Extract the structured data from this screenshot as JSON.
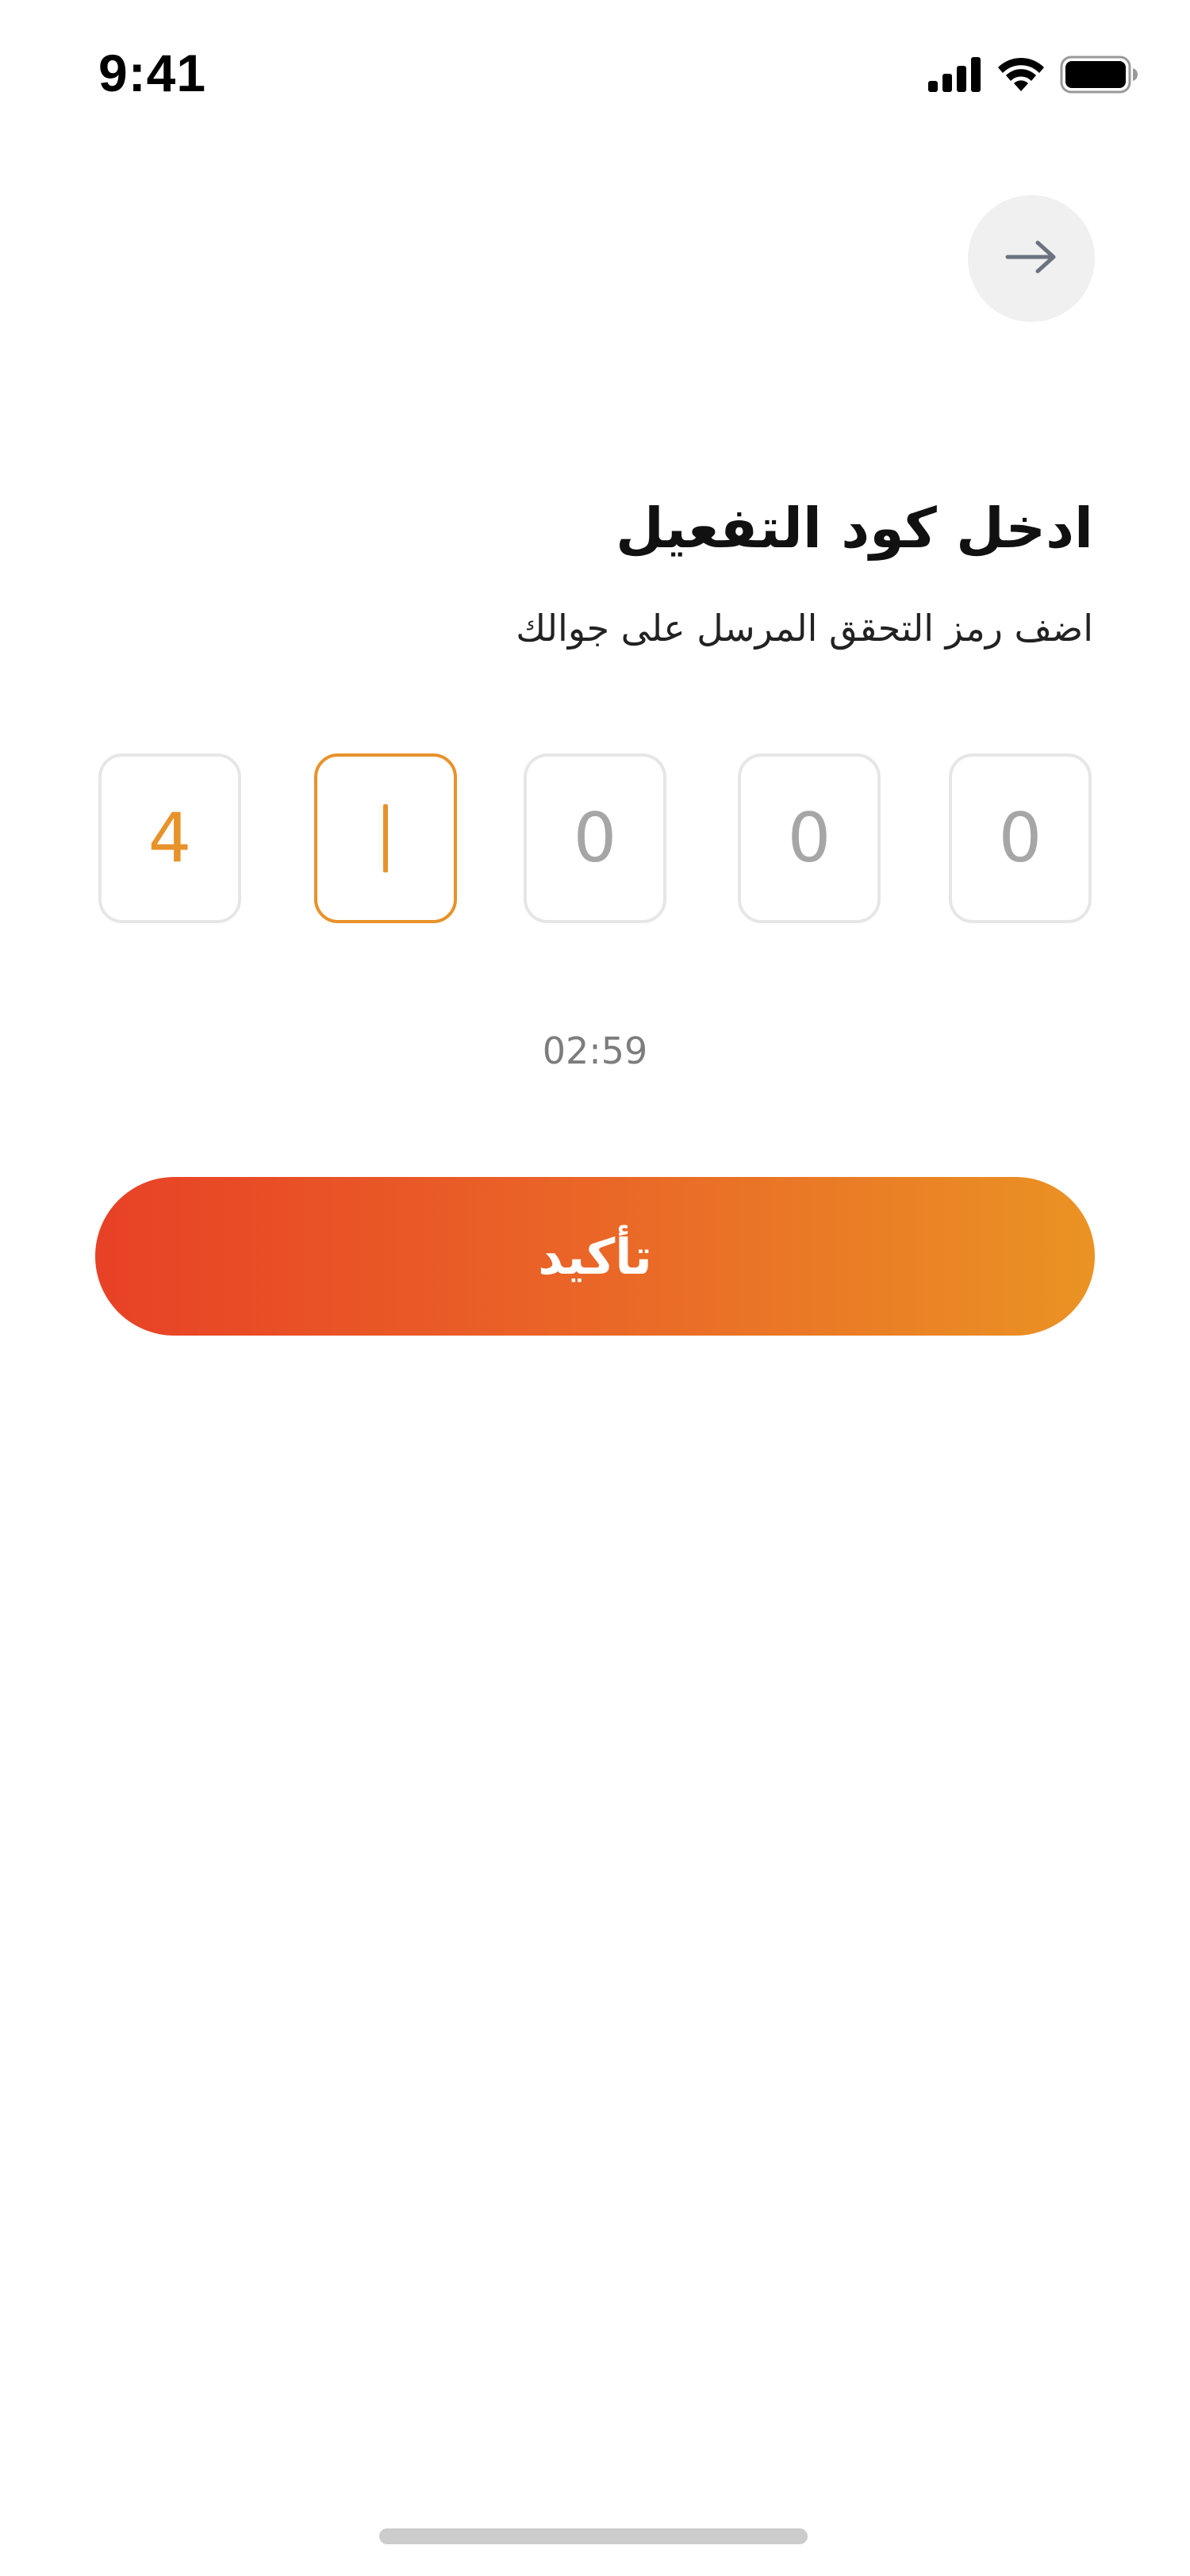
{
  "status_bar": {
    "time": "9:41",
    "icons": [
      "cellular-signal-icon",
      "wifi-icon",
      "battery-icon"
    ]
  },
  "header": {
    "back_icon": "arrow-right-icon"
  },
  "verification": {
    "title": "ادخل كود التفعيل",
    "subtitle": "اضف رمز التحقق المرسل على جوالك",
    "code_digits": [
      "4",
      "",
      "0",
      "0",
      "0"
    ],
    "active_index": 1,
    "timer": "02:59",
    "confirm_label": "تأكيد"
  },
  "colors": {
    "accent": "#e8922a",
    "gradient_start": "#e84126",
    "gradient_end": "#ea9324",
    "box_border": "#e6e6e6",
    "placeholder_digit": "#a6a6a6",
    "timer_text": "#7d7d7d",
    "back_button_bg": "#f0f0f0"
  }
}
